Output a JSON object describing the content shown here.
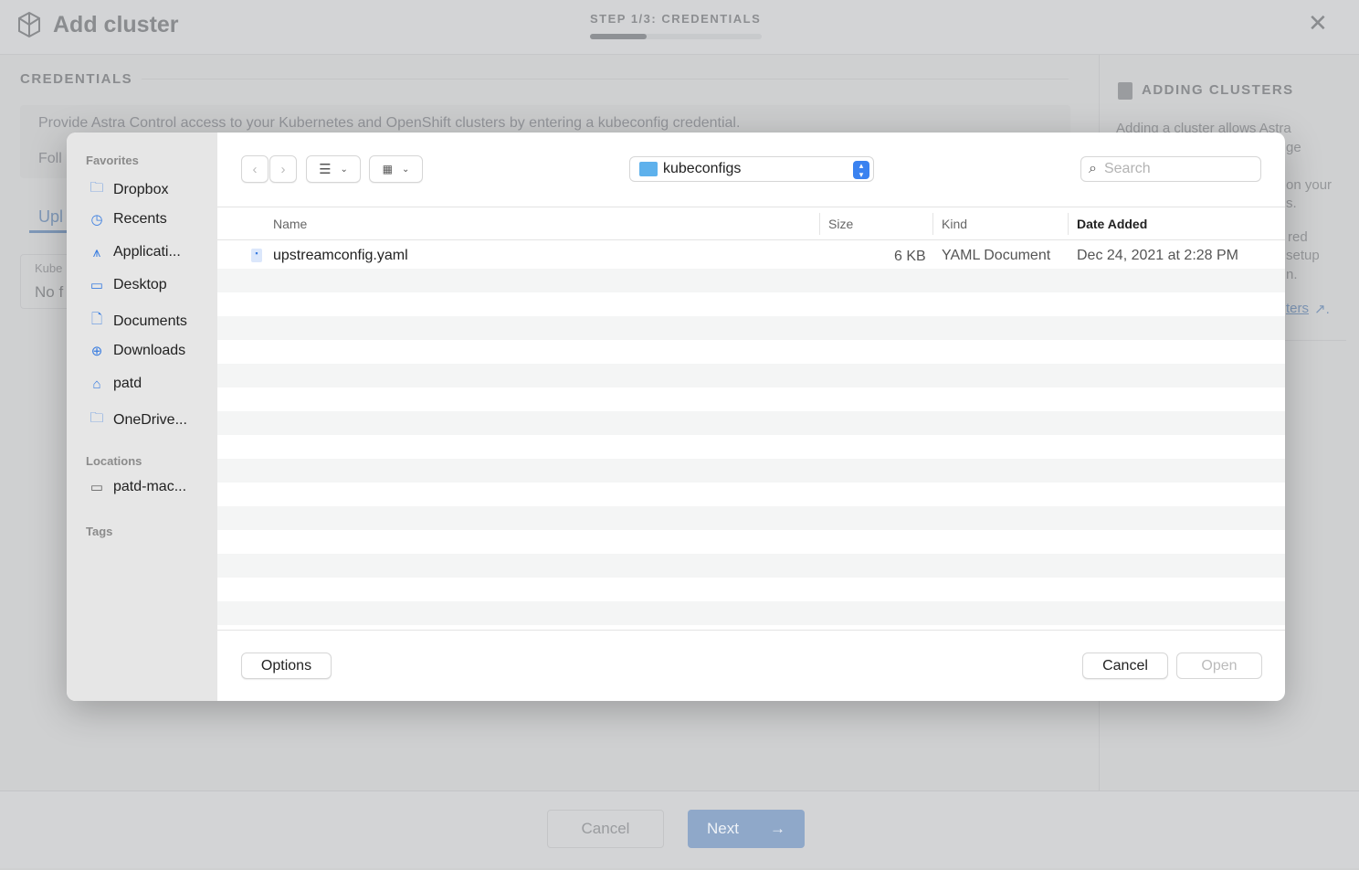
{
  "header": {
    "title": "Add cluster",
    "step": "STEP 1/3: CREDENTIALS",
    "progress_fraction": 0.33,
    "close_icon": "close-icon"
  },
  "main": {
    "section_title": "CREDENTIALS",
    "info_text": "Provide Astra Control access to your Kubernetes and OpenShift clusters by entering a kubeconfig credential.",
    "follow_text": "Foll",
    "upload_tab": "Upl",
    "kubeconfig_label": "Kube",
    "no_file": "No f"
  },
  "help": {
    "title": "ADDING CLUSTERS",
    "lines": [
      "Adding a cluster allows Astra",
      "ge",
      "on your",
      "s.",
      "red",
      "setup",
      "n."
    ],
    "link": "ters"
  },
  "footer": {
    "cancel": "Cancel",
    "next": "Next"
  },
  "dialog": {
    "sidebar": {
      "favorites_label": "Favorites",
      "favorites": [
        {
          "label": "Dropbox",
          "icon": "folder-icon"
        },
        {
          "label": "Recents",
          "icon": "clock-icon"
        },
        {
          "label": "Applicati...",
          "icon": "applications-icon"
        },
        {
          "label": "Desktop",
          "icon": "desktop-icon"
        },
        {
          "label": "Documents",
          "icon": "document-icon"
        },
        {
          "label": "Downloads",
          "icon": "download-icon"
        },
        {
          "label": "patd",
          "icon": "home-icon"
        },
        {
          "label": "OneDrive...",
          "icon": "folder-icon"
        }
      ],
      "locations_label": "Locations",
      "locations": [
        {
          "label": "patd-mac...",
          "icon": "laptop-icon"
        }
      ],
      "tags_label": "Tags"
    },
    "folder": "kubeconfigs",
    "search_placeholder": "Search",
    "columns": [
      "Name",
      "Size",
      "Kind",
      "Date Added"
    ],
    "files": [
      {
        "name": "upstreamconfig.yaml",
        "size": "6 KB",
        "kind": "YAML Document",
        "date_added": "Dec 24, 2021 at 2:28 PM"
      }
    ],
    "options": "Options",
    "cancel": "Cancel",
    "open": "Open"
  }
}
